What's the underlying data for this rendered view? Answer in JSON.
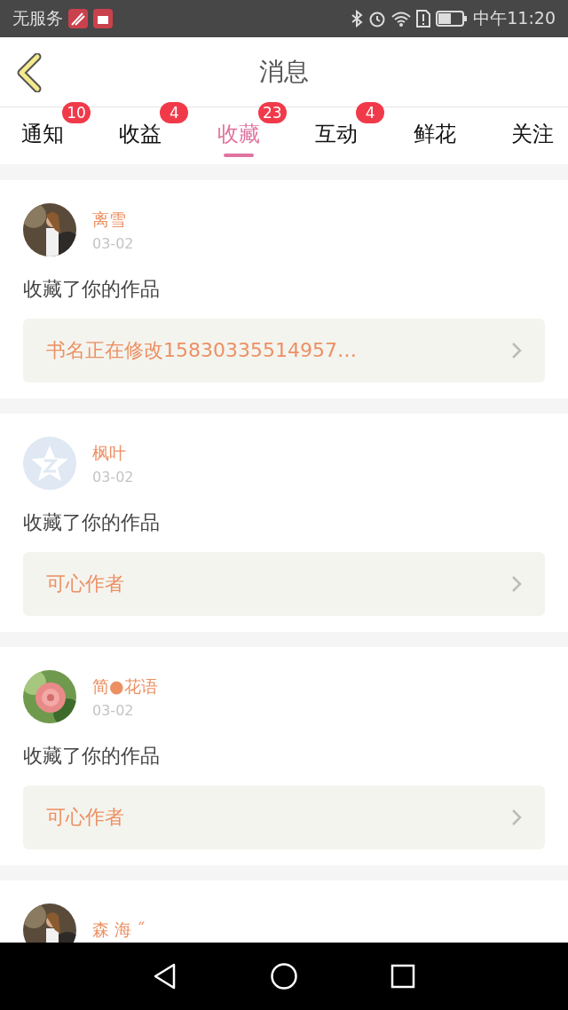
{
  "status_bar": {
    "carrier": "无服务",
    "time": "中午11:20"
  },
  "header": {
    "title": "消息"
  },
  "tabs": [
    {
      "label": "通知",
      "badge": "10",
      "selected": false
    },
    {
      "label": "收益",
      "badge": "4",
      "selected": false
    },
    {
      "label": "收藏",
      "badge": "23",
      "selected": true
    },
    {
      "label": "互动",
      "badge": "4",
      "selected": false
    },
    {
      "label": "鲜花",
      "selected": false
    },
    {
      "label": "关注",
      "selected": false
    }
  ],
  "messages": [
    {
      "name": "离雪",
      "date": "03-02",
      "text": "收藏了你的作品",
      "book": "书名正在修改15830335514957…"
    },
    {
      "avatar": {
        "kind": "icon"
      },
      "name": "枫叶",
      "date": "03-02",
      "text": "收藏了你的作品",
      "book": "可心作者"
    },
    {
      "name": "简●花语",
      "date": "03-02",
      "text": "收藏了你的作品",
      "book": "可心作者"
    },
    {
      "name": "森 海 ˝"
    }
  ]
}
